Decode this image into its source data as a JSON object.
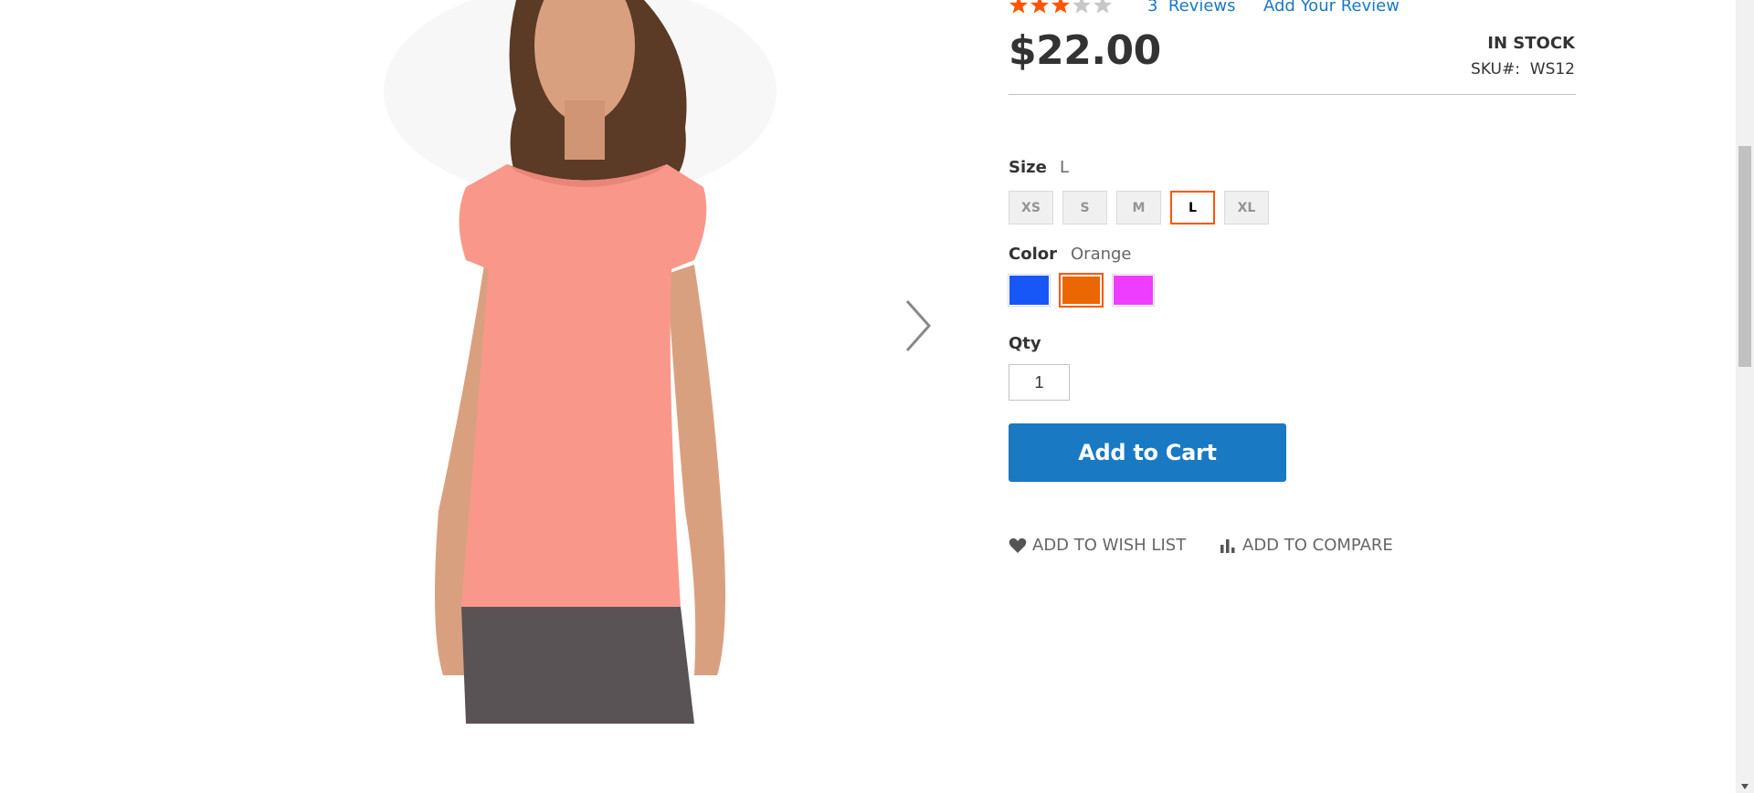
{
  "rating": {
    "stars_filled": 3,
    "stars_total": 5,
    "reviews_count": "3",
    "reviews_word": "Reviews",
    "add_review": "Add Your Review"
  },
  "product": {
    "price": "$22.00",
    "stock": "IN STOCK",
    "sku_label": "SKU#:",
    "sku_value": "WS12"
  },
  "size": {
    "label": "Size",
    "selected": "L",
    "options": [
      "XS",
      "S",
      "M",
      "L",
      "XL"
    ]
  },
  "color": {
    "label": "Color",
    "selected": "Orange",
    "options": [
      {
        "name": "Blue",
        "hex": "#1857f7"
      },
      {
        "name": "Orange",
        "hex": "#eb6703"
      },
      {
        "name": "Purple",
        "hex": "#ef3dff"
      }
    ]
  },
  "qty": {
    "label": "Qty",
    "value": "1"
  },
  "actions": {
    "add_to_cart": "Add to Cart",
    "wish_list": "Add to Wish List",
    "compare": "Add to Compare"
  },
  "colors": {
    "accent": "#1979c3",
    "selected_border": "#ff5501",
    "star": "#ff5501",
    "star_empty": "#c7c7c7",
    "shirt": "#f9988a"
  }
}
